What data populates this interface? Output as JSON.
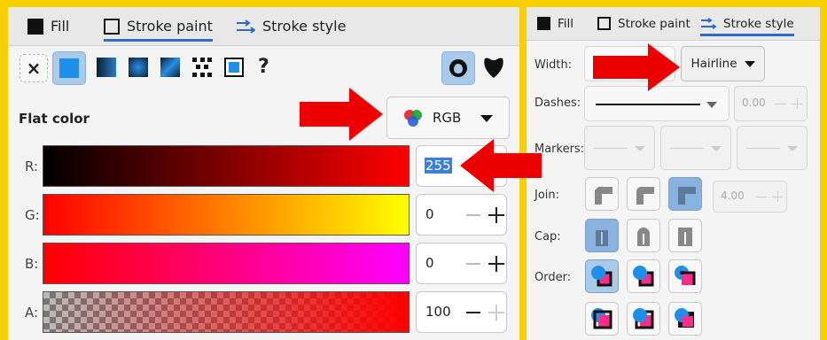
{
  "left_panel": {
    "tabs": [
      {
        "label": "Fill"
      },
      {
        "label": "Stroke paint"
      },
      {
        "label": "Stroke style"
      }
    ],
    "paint_types": [
      "none",
      "flat-color",
      "linear-gradient",
      "radial-gradient",
      "mesh-gradient",
      "pattern",
      "swatch",
      "unset"
    ],
    "unset_glyph": "?",
    "none_glyph": "×",
    "flat_color_label": "Flat color",
    "color_mode": "RGB",
    "channels": [
      {
        "label": "R:",
        "value": "255"
      },
      {
        "label": "G:",
        "value": "0"
      },
      {
        "label": "B:",
        "value": "0"
      },
      {
        "label": "A:",
        "value": "100"
      }
    ]
  },
  "right_panel": {
    "tabs": [
      {
        "label": "Fill"
      },
      {
        "label": "Stroke paint"
      },
      {
        "label": "Stroke style"
      }
    ],
    "width_label": "Width:",
    "width_unit": "Hairline",
    "dashes_label": "Dashes:",
    "dash_offset": "0.00",
    "markers_label": "Markers:",
    "join_label": "Join:",
    "miter_limit": "4.00",
    "cap_label": "Cap:",
    "order_label": "Order:"
  },
  "colors": {
    "background": "#f8d000",
    "accent": "#2d6bc4",
    "arrow": "#ee0000",
    "selected_blue": "#1e90e8",
    "marker_pink": "#ff2d8a"
  }
}
